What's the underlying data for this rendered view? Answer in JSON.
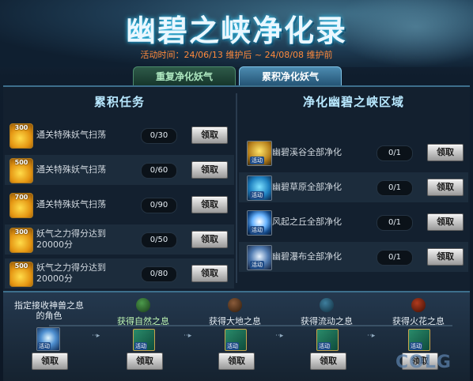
{
  "header": {
    "title": "幽碧之峡净化录",
    "dates_label": "活动时间：24/06/13 维护后 ~ 24/08/08 维护前"
  },
  "tabs": [
    {
      "label": "重复净化妖气",
      "active": false
    },
    {
      "label": "累积净化妖气",
      "active": true
    }
  ],
  "left_section": {
    "title": "累积任务",
    "tasks": [
      {
        "reward": "300",
        "label": "通关特殊妖气扫荡",
        "label2": "",
        "progress": "0/30",
        "button": "领取"
      },
      {
        "reward": "500",
        "label": "通关特殊妖气扫荡",
        "label2": "",
        "progress": "0/60",
        "button": "领取"
      },
      {
        "reward": "700",
        "label": "通关特殊妖气扫荡",
        "label2": "",
        "progress": "0/90",
        "button": "领取"
      },
      {
        "reward": "300",
        "label": "妖气之力得分达到",
        "label2": "20000分",
        "progress": "0/50",
        "button": "领取"
      },
      {
        "reward": "500",
        "label": "妖气之力得分达到",
        "label2": "20000分",
        "progress": "0/80",
        "button": "领取"
      }
    ]
  },
  "right_section": {
    "title": "净化幽碧之峡区域",
    "regions": [
      {
        "label": "幽碧溪谷全部净化",
        "progress": "0/1",
        "button": "领取",
        "tag": "活动"
      },
      {
        "label": "幽碧草原全部净化",
        "progress": "0/1",
        "button": "领取",
        "tag": "活动"
      },
      {
        "label": "风起之丘全部净化",
        "progress": "0/1",
        "button": "领取",
        "tag": "活动"
      },
      {
        "label": "幽碧瀑布全部净化",
        "progress": "0/1",
        "button": "领取",
        "tag": "活动"
      }
    ]
  },
  "bottom": {
    "first": {
      "label": "指定接收神兽之息的角色",
      "button": "领取",
      "tag": "活动"
    },
    "steps": [
      {
        "label": "获得自然之息",
        "button": "领取",
        "tag": "活动"
      },
      {
        "label": "获得大地之息",
        "button": "领取",
        "tag": "活动"
      },
      {
        "label": "获得流动之息",
        "button": "领取",
        "tag": "活动"
      },
      {
        "label": "获得火花之息",
        "button": "领取",
        "tag": "活动"
      }
    ],
    "arrow": "··▸"
  },
  "watermark": "COLG"
}
